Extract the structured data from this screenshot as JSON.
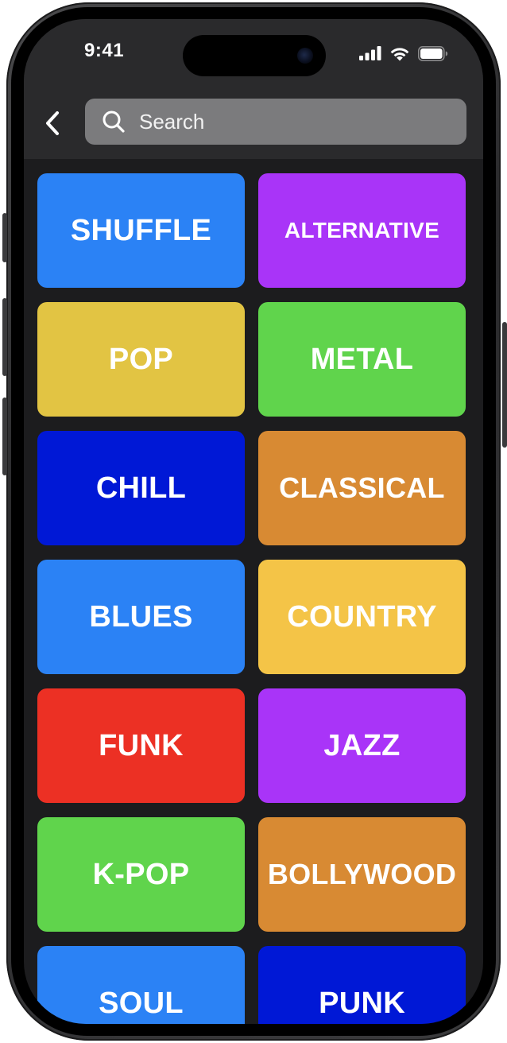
{
  "status_bar": {
    "time": "9:41",
    "icons": [
      "cellular-signal-icon",
      "wifi-icon",
      "battery-icon"
    ]
  },
  "header": {
    "back_icon": "chevron-left-icon",
    "search": {
      "placeholder": "Search",
      "value": "",
      "icon": "search-icon"
    }
  },
  "genres": [
    {
      "label": "SHUFFLE",
      "color": "#2B82F5"
    },
    {
      "label": "ALTERNATIVE",
      "color": "#A934F8"
    },
    {
      "label": "POP",
      "color": "#E2C443"
    },
    {
      "label": "METAL",
      "color": "#60D44C"
    },
    {
      "label": "CHILL",
      "color": "#0018D6"
    },
    {
      "label": "CLASSICAL",
      "color": "#D88A33"
    },
    {
      "label": "BLUES",
      "color": "#2B82F5"
    },
    {
      "label": "COUNTRY",
      "color": "#F4C447"
    },
    {
      "label": "FUNK",
      "color": "#EC3024"
    },
    {
      "label": "JAZZ",
      "color": "#A934F8"
    },
    {
      "label": "K-POP",
      "color": "#60D44C"
    },
    {
      "label": "BOLLYWOOD",
      "color": "#D88A33"
    },
    {
      "label": "SOUL",
      "color": "#2B82F5"
    },
    {
      "label": "PUNK",
      "color": "#0018D6"
    }
  ],
  "colors": {
    "screen_background": "#1C1C1E",
    "header_background": "#2A2A2C",
    "search_background": "#7B7B7D",
    "text": "#FFFFFF"
  }
}
